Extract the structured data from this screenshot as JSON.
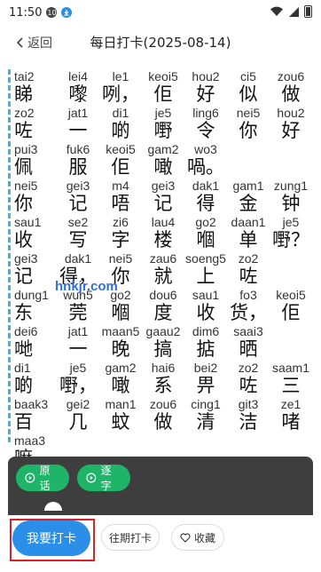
{
  "status": {
    "time": "11:50",
    "badge1": "10"
  },
  "header": {
    "back_label": "返回",
    "title": "每日打卡(2025-08-14)"
  },
  "watermark": "hnkjr.com",
  "lines": [
    [
      {
        "py": "tai2",
        "hz": "睇"
      },
      {
        "py": "lei4",
        "hz": "嚟"
      },
      {
        "py": "le1",
        "hz": "咧，"
      },
      {
        "py": "keoi5",
        "hz": "佢"
      },
      {
        "py": "hou2",
        "hz": "好"
      },
      {
        "py": "ci5",
        "hz": "似"
      },
      {
        "py": "zou6",
        "hz": "做"
      }
    ],
    [
      {
        "py": "zo2",
        "hz": "咗"
      },
      {
        "py": "jat1",
        "hz": "一"
      },
      {
        "py": "di1",
        "hz": "啲"
      },
      {
        "py": "je5",
        "hz": "嘢"
      },
      {
        "py": "ling6",
        "hz": "令"
      },
      {
        "py": "nei5",
        "hz": "你"
      },
      {
        "py": "hou2",
        "hz": "好"
      }
    ],
    [
      {
        "py": "pui3",
        "hz": "佩"
      },
      {
        "py": "fuk6",
        "hz": "服"
      },
      {
        "py": "keoi5",
        "hz": "佢"
      },
      {
        "py": "gam2",
        "hz": "噉"
      },
      {
        "py": "wo3",
        "hz": "喎。"
      }
    ],
    [
      {
        "py": "nei5",
        "hz": "你"
      },
      {
        "py": "gei3",
        "hz": "记"
      },
      {
        "py": "m4",
        "hz": "唔"
      },
      {
        "py": "gei3",
        "hz": "记"
      },
      {
        "py": "dak1",
        "hz": "得"
      },
      {
        "py": "gam1",
        "hz": "金"
      },
      {
        "py": "zung1",
        "hz": "钟"
      }
    ],
    [
      {
        "py": "sau1",
        "hz": "收"
      },
      {
        "py": "se2",
        "hz": "写"
      },
      {
        "py": "zi6",
        "hz": "字"
      },
      {
        "py": "lau4",
        "hz": "楼"
      },
      {
        "py": "go2",
        "hz": "嗰"
      },
      {
        "py": "daan1",
        "hz": "单"
      },
      {
        "py": "je5",
        "hz": "嘢？"
      }
    ],
    [
      {
        "py": "gei3",
        "hz": "记"
      },
      {
        "py": "dak1",
        "hz": "得，"
      },
      {
        "py": "nei5",
        "hz": "你"
      },
      {
        "py": "zau6",
        "hz": "就"
      },
      {
        "py": "soeng5",
        "hz": "上"
      },
      {
        "py": "zo2",
        "hz": "咗"
      }
    ],
    [
      {
        "py": "dung1",
        "hz": "东"
      },
      {
        "py": "wun5",
        "hz": "莞"
      },
      {
        "py": "go2",
        "hz": "嗰"
      },
      {
        "py": "dou6",
        "hz": "度"
      },
      {
        "py": "sau1",
        "hz": "收"
      },
      {
        "py": "fo3",
        "hz": "货，"
      },
      {
        "py": "keoi5",
        "hz": "佢"
      }
    ],
    [
      {
        "py": "dei6",
        "hz": "哋"
      },
      {
        "py": "jat1",
        "hz": "一"
      },
      {
        "py": "maan5",
        "hz": "晚"
      },
      {
        "py": "gaau2",
        "hz": "搞"
      },
      {
        "py": "dim6",
        "hz": "掂"
      },
      {
        "py": "saai3",
        "hz": "晒"
      }
    ],
    [
      {
        "py": "di1",
        "hz": "啲"
      },
      {
        "py": "je5",
        "hz": "嘢，"
      },
      {
        "py": "gam2",
        "hz": "噉"
      },
      {
        "py": "hai6",
        "hz": "系"
      },
      {
        "py": "bei2",
        "hz": "畀"
      },
      {
        "py": "zo2",
        "hz": "咗"
      },
      {
        "py": "saam1",
        "hz": "三"
      }
    ],
    [
      {
        "py": "baak3",
        "hz": "百"
      },
      {
        "py": "gei2",
        "hz": "几"
      },
      {
        "py": "man1",
        "hz": "蚊"
      },
      {
        "py": "zou6",
        "hz": "做"
      },
      {
        "py": "cing1",
        "hz": "清"
      },
      {
        "py": "git3",
        "hz": "洁"
      },
      {
        "py": "ze1",
        "hz": "啫"
      }
    ],
    [
      {
        "py": "maa3",
        "hz": "嘛。"
      }
    ]
  ],
  "player": {
    "chip_original": "原话",
    "chip_word": "逐字"
  },
  "bottom": {
    "checkin": "我要打卡",
    "history": "往期打卡",
    "favorite": "收藏"
  }
}
